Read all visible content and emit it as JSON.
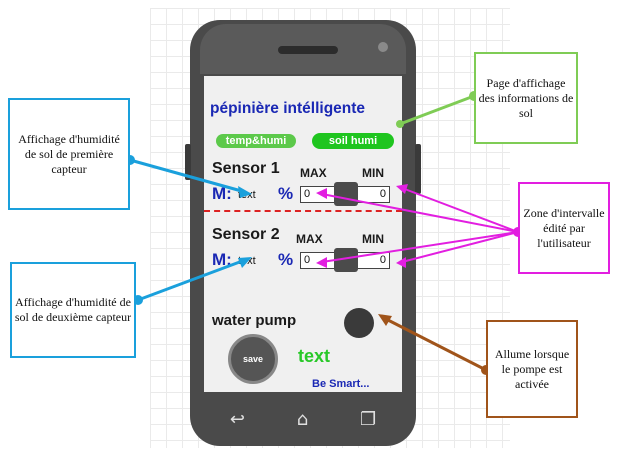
{
  "app": {
    "title": "pépinière intélligente",
    "tabs": [
      "temp&humi",
      "soil humi"
    ],
    "sensor1": {
      "label": "Sensor 1",
      "max": "MAX",
      "min": "MIN",
      "m": "M:",
      "text": "text",
      "pct": "%",
      "left_value": "0",
      "right_value": "0"
    },
    "sensor2": {
      "label": "Sensor 2",
      "max": "MAX",
      "min": "MIN",
      "m": "M:",
      "text": "text",
      "pct": "%",
      "left_value": "0",
      "right_value": "0"
    },
    "pump_label": "water pump",
    "save_label": "save",
    "status_text": "text",
    "slogan": "Be Smart..."
  },
  "callouts": {
    "sensor1_display": "Affichage d'humidité de sol de première capteur",
    "sensor2_display": "Affichage d'humidité de sol de deuxième capteur",
    "soil_page": "Page d'affichage des informations de sol",
    "range_zone": "Zone d'intervalle édité par l'utilisateur",
    "pump_led": "Allume lorsque le pompe est activée"
  },
  "colors": {
    "blue_callout": "#1aa0dc",
    "green_callout": "#7fcc55",
    "magenta_callout": "#e21ee0",
    "brown_callout": "#a0541a",
    "app_blue": "#1a28b4",
    "tab_green": "#1fc51f"
  },
  "icons": [
    "back-icon",
    "home-icon",
    "recent-apps-icon"
  ]
}
